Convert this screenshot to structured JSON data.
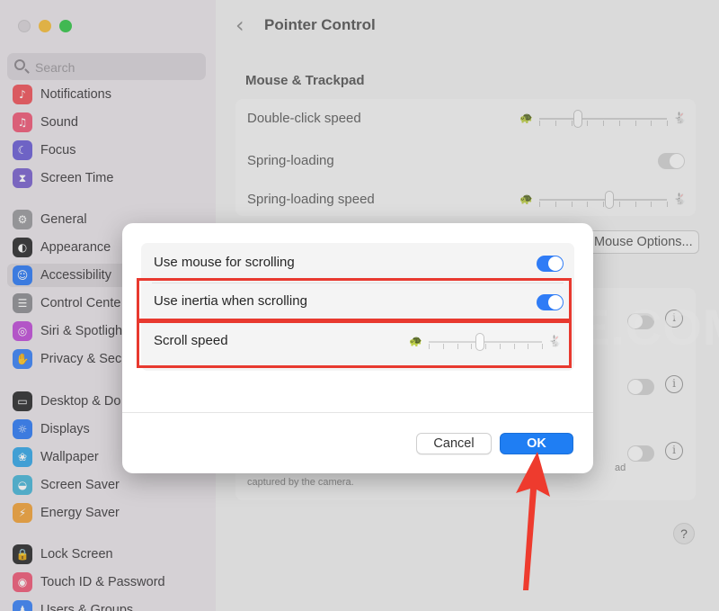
{
  "sidebar": {
    "search_placeholder": "Search",
    "items": [
      {
        "label": "Notifications",
        "icon": "bell-icon",
        "color": "#f0535b"
      },
      {
        "label": "Sound",
        "icon": "speaker-icon",
        "color": "#f05a78"
      },
      {
        "label": "Focus",
        "icon": "moon-icon",
        "color": "#6c5fd6"
      },
      {
        "label": "Screen Time",
        "icon": "hourglass-icon",
        "color": "#7a62cf"
      },
      {
        "label": "General",
        "icon": "gear-icon",
        "color": "#9a9a9e"
      },
      {
        "label": "Appearance",
        "icon": "appearance-icon",
        "color": "#2c2c2e"
      },
      {
        "label": "Accessibility",
        "icon": "accessibility-icon",
        "color": "#2f7cf6"
      },
      {
        "label": "Control Cente",
        "icon": "control-center-icon",
        "color": "#8e8e93"
      },
      {
        "label": "Siri & Spotligh",
        "icon": "siri-icon",
        "color": "#c04ed8"
      },
      {
        "label": "Privacy & Sec",
        "icon": "hand-icon",
        "color": "#3a82f7"
      },
      {
        "label": "Desktop & Do",
        "icon": "desktop-icon",
        "color": "#2c2c2e"
      },
      {
        "label": "Displays",
        "icon": "sun-icon",
        "color": "#2f7cf6"
      },
      {
        "label": "Wallpaper",
        "icon": "wallpaper-icon",
        "color": "#35a8e8"
      },
      {
        "label": "Screen Saver",
        "icon": "screen-saver-icon",
        "color": "#48b6d8"
      },
      {
        "label": "Energy Saver",
        "icon": "battery-icon",
        "color": "#f2a33a"
      },
      {
        "label": "Lock Screen",
        "icon": "lock-icon",
        "color": "#2c2c2e"
      },
      {
        "label": "Touch ID & Password",
        "icon": "fingerprint-icon",
        "color": "#f05a78"
      },
      {
        "label": "Users & Groups",
        "icon": "users-icon",
        "color": "#3a82f7"
      }
    ],
    "selected_index": 6
  },
  "main": {
    "back_glyph": "‹",
    "title": "Pointer Control",
    "section": "Mouse & Trackpad",
    "rows": {
      "double_click": "Double-click speed",
      "spring_loading": "Spring-loading",
      "spring_loading_speed": "Spring-loading speed"
    },
    "mouse_options_label": "Mouse Options...",
    "footer_text": "captured by the camera.",
    "footer_text_right": "ad",
    "help_glyph": "?",
    "info_glyph": "i"
  },
  "sliders": {
    "double_click_level": 0.3,
    "spring_loading_speed_level": 0.55,
    "scroll_speed_level": 0.45,
    "slow_glyph": "🐢",
    "fast_glyph": "🐇"
  },
  "dialog": {
    "use_mouse_label": "Use mouse for scrolling",
    "use_mouse_on": true,
    "inertia_label": "Use inertia when scrolling",
    "inertia_on": true,
    "scroll_speed_label": "Scroll speed",
    "cancel_label": "Cancel",
    "ok_label": "OK"
  },
  "watermark": "UHOWTOISOLVE.COM",
  "colors": {
    "accent": "#2f7cf6",
    "highlight": "#e8392f",
    "ok_button": "#1f7ef3"
  }
}
